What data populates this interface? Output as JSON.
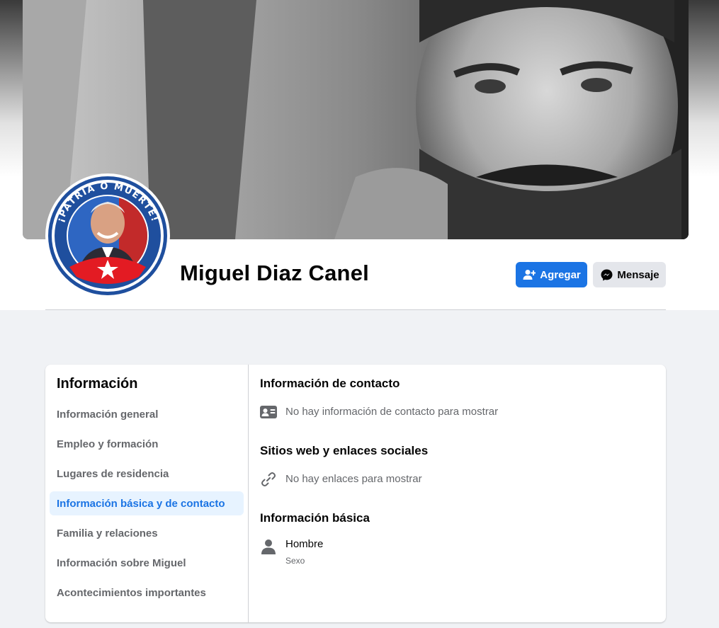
{
  "profile": {
    "name": "Miguel Diaz Canel",
    "avatar_text": "¡PATRIA O MUERTE!"
  },
  "actions": {
    "add_label": "Agregar",
    "add_icon": "add-friend-icon",
    "message_label": "Mensaje",
    "message_icon": "messenger-icon"
  },
  "about": {
    "title": "Información",
    "nav": [
      {
        "label": "Información general",
        "active": false
      },
      {
        "label": "Empleo y formación",
        "active": false
      },
      {
        "label": "Lugares de residencia",
        "active": false
      },
      {
        "label": "Información básica y de contacto",
        "active": true
      },
      {
        "label": "Familia y relaciones",
        "active": false
      },
      {
        "label": "Información sobre Miguel",
        "active": false
      },
      {
        "label": "Acontecimientos importantes",
        "active": false
      }
    ],
    "contact": {
      "title": "Información de contacto",
      "empty": "No hay información de contacto para mostrar",
      "icon": "contact-card-icon"
    },
    "websites": {
      "title": "Sitios web y enlaces sociales",
      "empty": "No hay enlaces para mostrar",
      "icon": "link-icon"
    },
    "basic": {
      "title": "Información básica",
      "gender_value": "Hombre",
      "gender_label": "Sexo",
      "icon": "person-icon"
    }
  },
  "colors": {
    "accent": "#1b74e4",
    "active_bg": "#e7f3ff",
    "page_bg": "#f0f2f5",
    "cuba_red": "#e31b23",
    "cuba_blue": "#1f4f9e"
  }
}
